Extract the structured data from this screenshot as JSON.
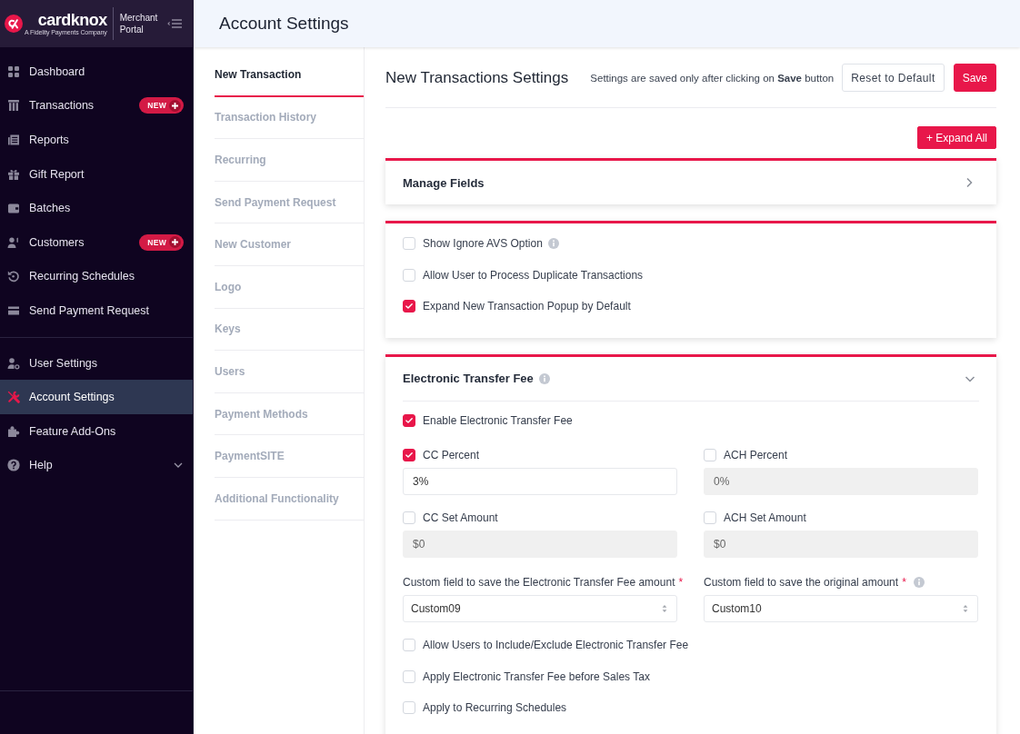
{
  "sidebar": {
    "brand": {
      "name": "cardknox",
      "tagline": "A Fidelity Payments Company",
      "portal": "Merchant Portal"
    },
    "sections": [
      {
        "items": [
          {
            "label": "Dashboard",
            "kind": "link",
            "selected": false
          },
          {
            "label": "Transactions",
            "kind": "link",
            "selected": false,
            "badge": "NEW"
          },
          {
            "label": "Reports",
            "kind": "link",
            "selected": false
          },
          {
            "label": "Gift Report",
            "kind": "link",
            "selected": false
          },
          {
            "label": "Batches",
            "kind": "link",
            "selected": false
          },
          {
            "label": "Customers",
            "kind": "link",
            "selected": false,
            "badge": "NEW"
          },
          {
            "label": "Recurring Schedules",
            "kind": "link",
            "selected": false
          },
          {
            "label": "Send Payment Request",
            "kind": "link",
            "selected": false
          }
        ]
      },
      {
        "items": [
          {
            "label": "User Settings",
            "kind": "link",
            "selected": false
          },
          {
            "label": "Account Settings",
            "kind": "link",
            "selected": true
          },
          {
            "label": "Feature Add-Ons",
            "kind": "link",
            "selected": false
          },
          {
            "label": "Help",
            "kind": "group",
            "selected": false
          }
        ]
      }
    ]
  },
  "header": {
    "title": "Account Settings"
  },
  "settings_nav": {
    "items": [
      {
        "label": "New Transaction",
        "selected": true
      },
      {
        "label": "Transaction History",
        "selected": false
      },
      {
        "label": "Recurring",
        "selected": false
      },
      {
        "label": "Send Payment Request",
        "selected": false
      },
      {
        "label": "New Customer",
        "selected": false
      },
      {
        "label": "Logo",
        "selected": false
      },
      {
        "label": "Keys",
        "selected": false
      },
      {
        "label": "Users",
        "selected": false
      },
      {
        "label": "Payment Methods",
        "selected": false
      },
      {
        "label": "PaymentSITE",
        "selected": false
      },
      {
        "label": "Additional Functionality",
        "selected": false
      }
    ]
  },
  "content": {
    "title": "New Transactions Settings",
    "note": "Settings are saved only after clicking on **Save** button",
    "buttons": [
      {
        "label": "Reset to Default",
        "kind": "secondary"
      },
      {
        "label": "Save",
        "kind": "primary"
      }
    ],
    "expand_all": "+ Expand All",
    "panels": [
      {
        "kind": "section",
        "title": "Manage Fields",
        "info": false,
        "expanded": false
      },
      {
        "kind": "options",
        "options": [
          {
            "label": "Show Ignore AVS Option",
            "checked": false,
            "info": true
          },
          {
            "label": "Allow User to Process Duplicate Transactions",
            "checked": false,
            "info": false
          },
          {
            "label": "Expand New Transaction Popup by Default",
            "checked": true,
            "info": false
          }
        ]
      },
      {
        "kind": "section",
        "title": "Electronic Transfer Fee",
        "info": true,
        "expanded": true,
        "options": [
          {
            "label": "Enable Electronic Transfer Fee",
            "checked": true,
            "info": false
          }
        ],
        "fields": [
          {
            "label": "CC Percent",
            "checked": true,
            "value": "3%",
            "disabled": false
          },
          {
            "label": "ACH Percent",
            "checked": false,
            "value": "0%",
            "disabled": true
          },
          {
            "label": "CC Set Amount",
            "checked": false,
            "value": "$0",
            "disabled": true
          },
          {
            "label": "ACH Set Amount",
            "checked": false,
            "value": "$0",
            "disabled": true
          }
        ],
        "selects": [
          {
            "label": "Custom field to save the Electronic Transfer Fee amount",
            "required_mark": "*",
            "info": false,
            "value": "Custom09"
          },
          {
            "label": "Custom field to save the original amount",
            "required_mark": "*",
            "info": true,
            "value": "Custom10"
          }
        ],
        "more_options": [
          {
            "label": "Allow Users to Include/Exclude Electronic Transfer Fee",
            "checked": false,
            "info": false
          },
          {
            "label": "Apply Electronic Transfer Fee before Sales Tax",
            "checked": false,
            "info": false
          },
          {
            "label": "Apply to Recurring Schedules",
            "checked": false,
            "info": false
          }
        ]
      }
    ]
  }
}
